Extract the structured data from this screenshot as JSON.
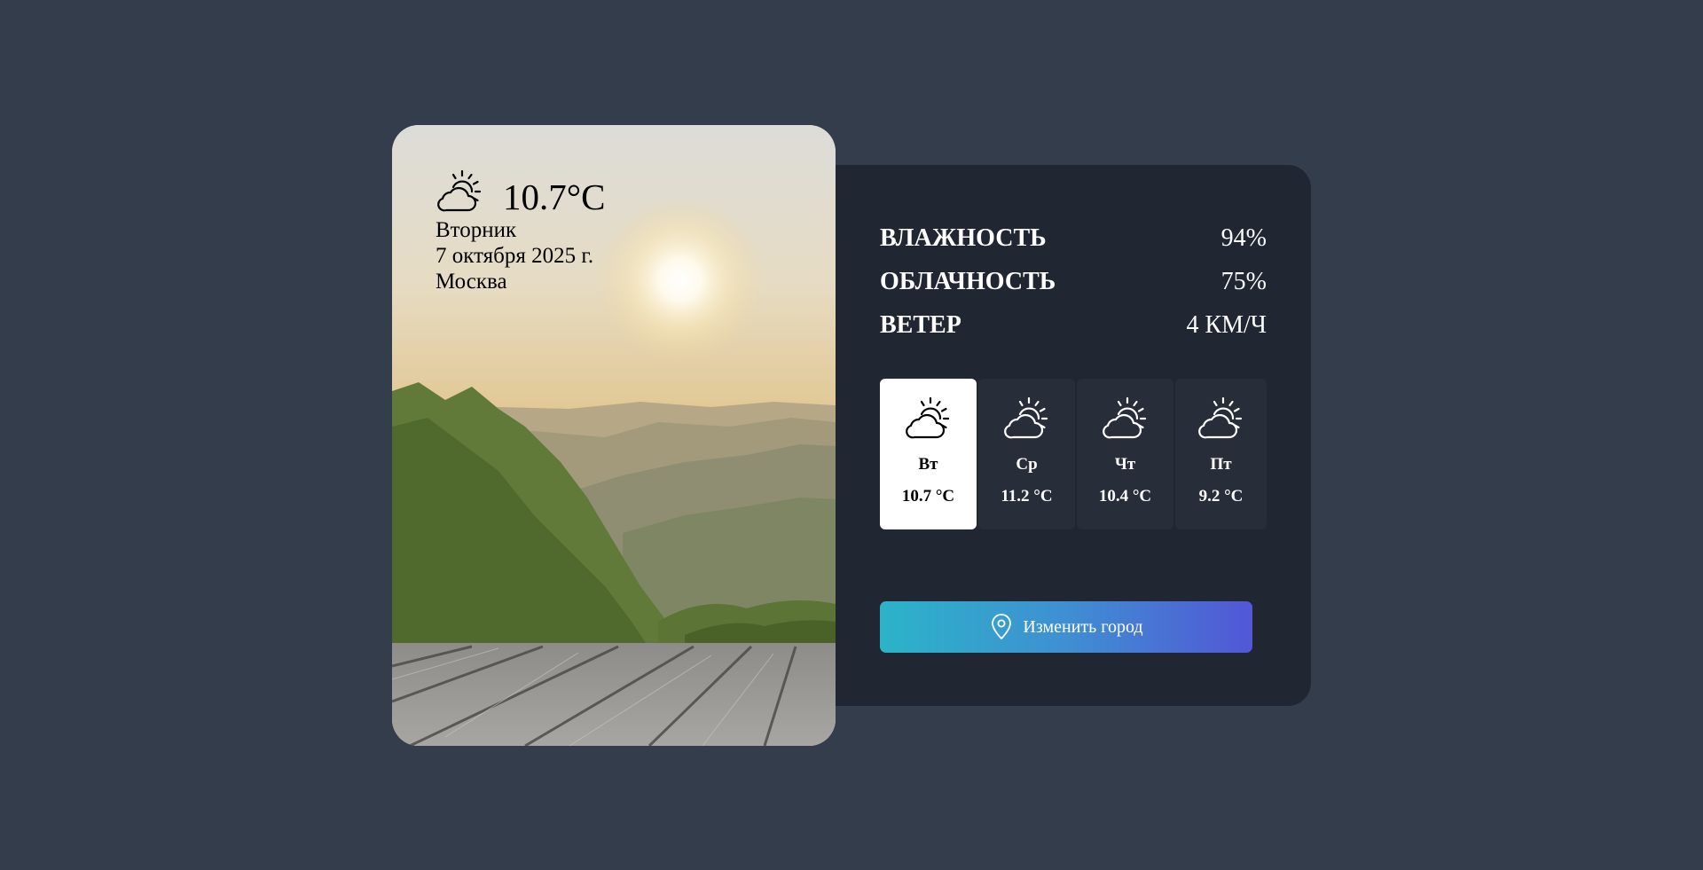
{
  "current": {
    "icon": "partly-cloudy-icon",
    "temperature": "10.7°C",
    "day": "Вторник",
    "date": "7 октября 2025 г.",
    "city": "Москва"
  },
  "stats": [
    {
      "label": "ВЛАЖНОСТЬ",
      "value": "94%"
    },
    {
      "label": "ОБЛАЧНОСТЬ",
      "value": "75%"
    },
    {
      "label": "ВЕТЕР",
      "value": "4 КМ/Ч"
    }
  ],
  "forecast": [
    {
      "day": "Вт",
      "temp": "10.7 °C",
      "icon": "partly-cloudy-icon",
      "selected": true
    },
    {
      "day": "Ср",
      "temp": "11.2 °C",
      "icon": "partly-cloudy-icon",
      "selected": false
    },
    {
      "day": "Чт",
      "temp": "10.4 °C",
      "icon": "partly-cloudy-icon",
      "selected": false
    },
    {
      "day": "Пт",
      "temp": "9.2 °C",
      "icon": "partly-cloudy-icon",
      "selected": false
    }
  ],
  "button": {
    "label": "Изменить город",
    "icon": "location-pin-icon"
  },
  "colors": {
    "page_background": "#343d4c",
    "panel_background": "#212732",
    "button_gradient_start": "#2bb4c8",
    "button_gradient_end": "#5257d6"
  }
}
